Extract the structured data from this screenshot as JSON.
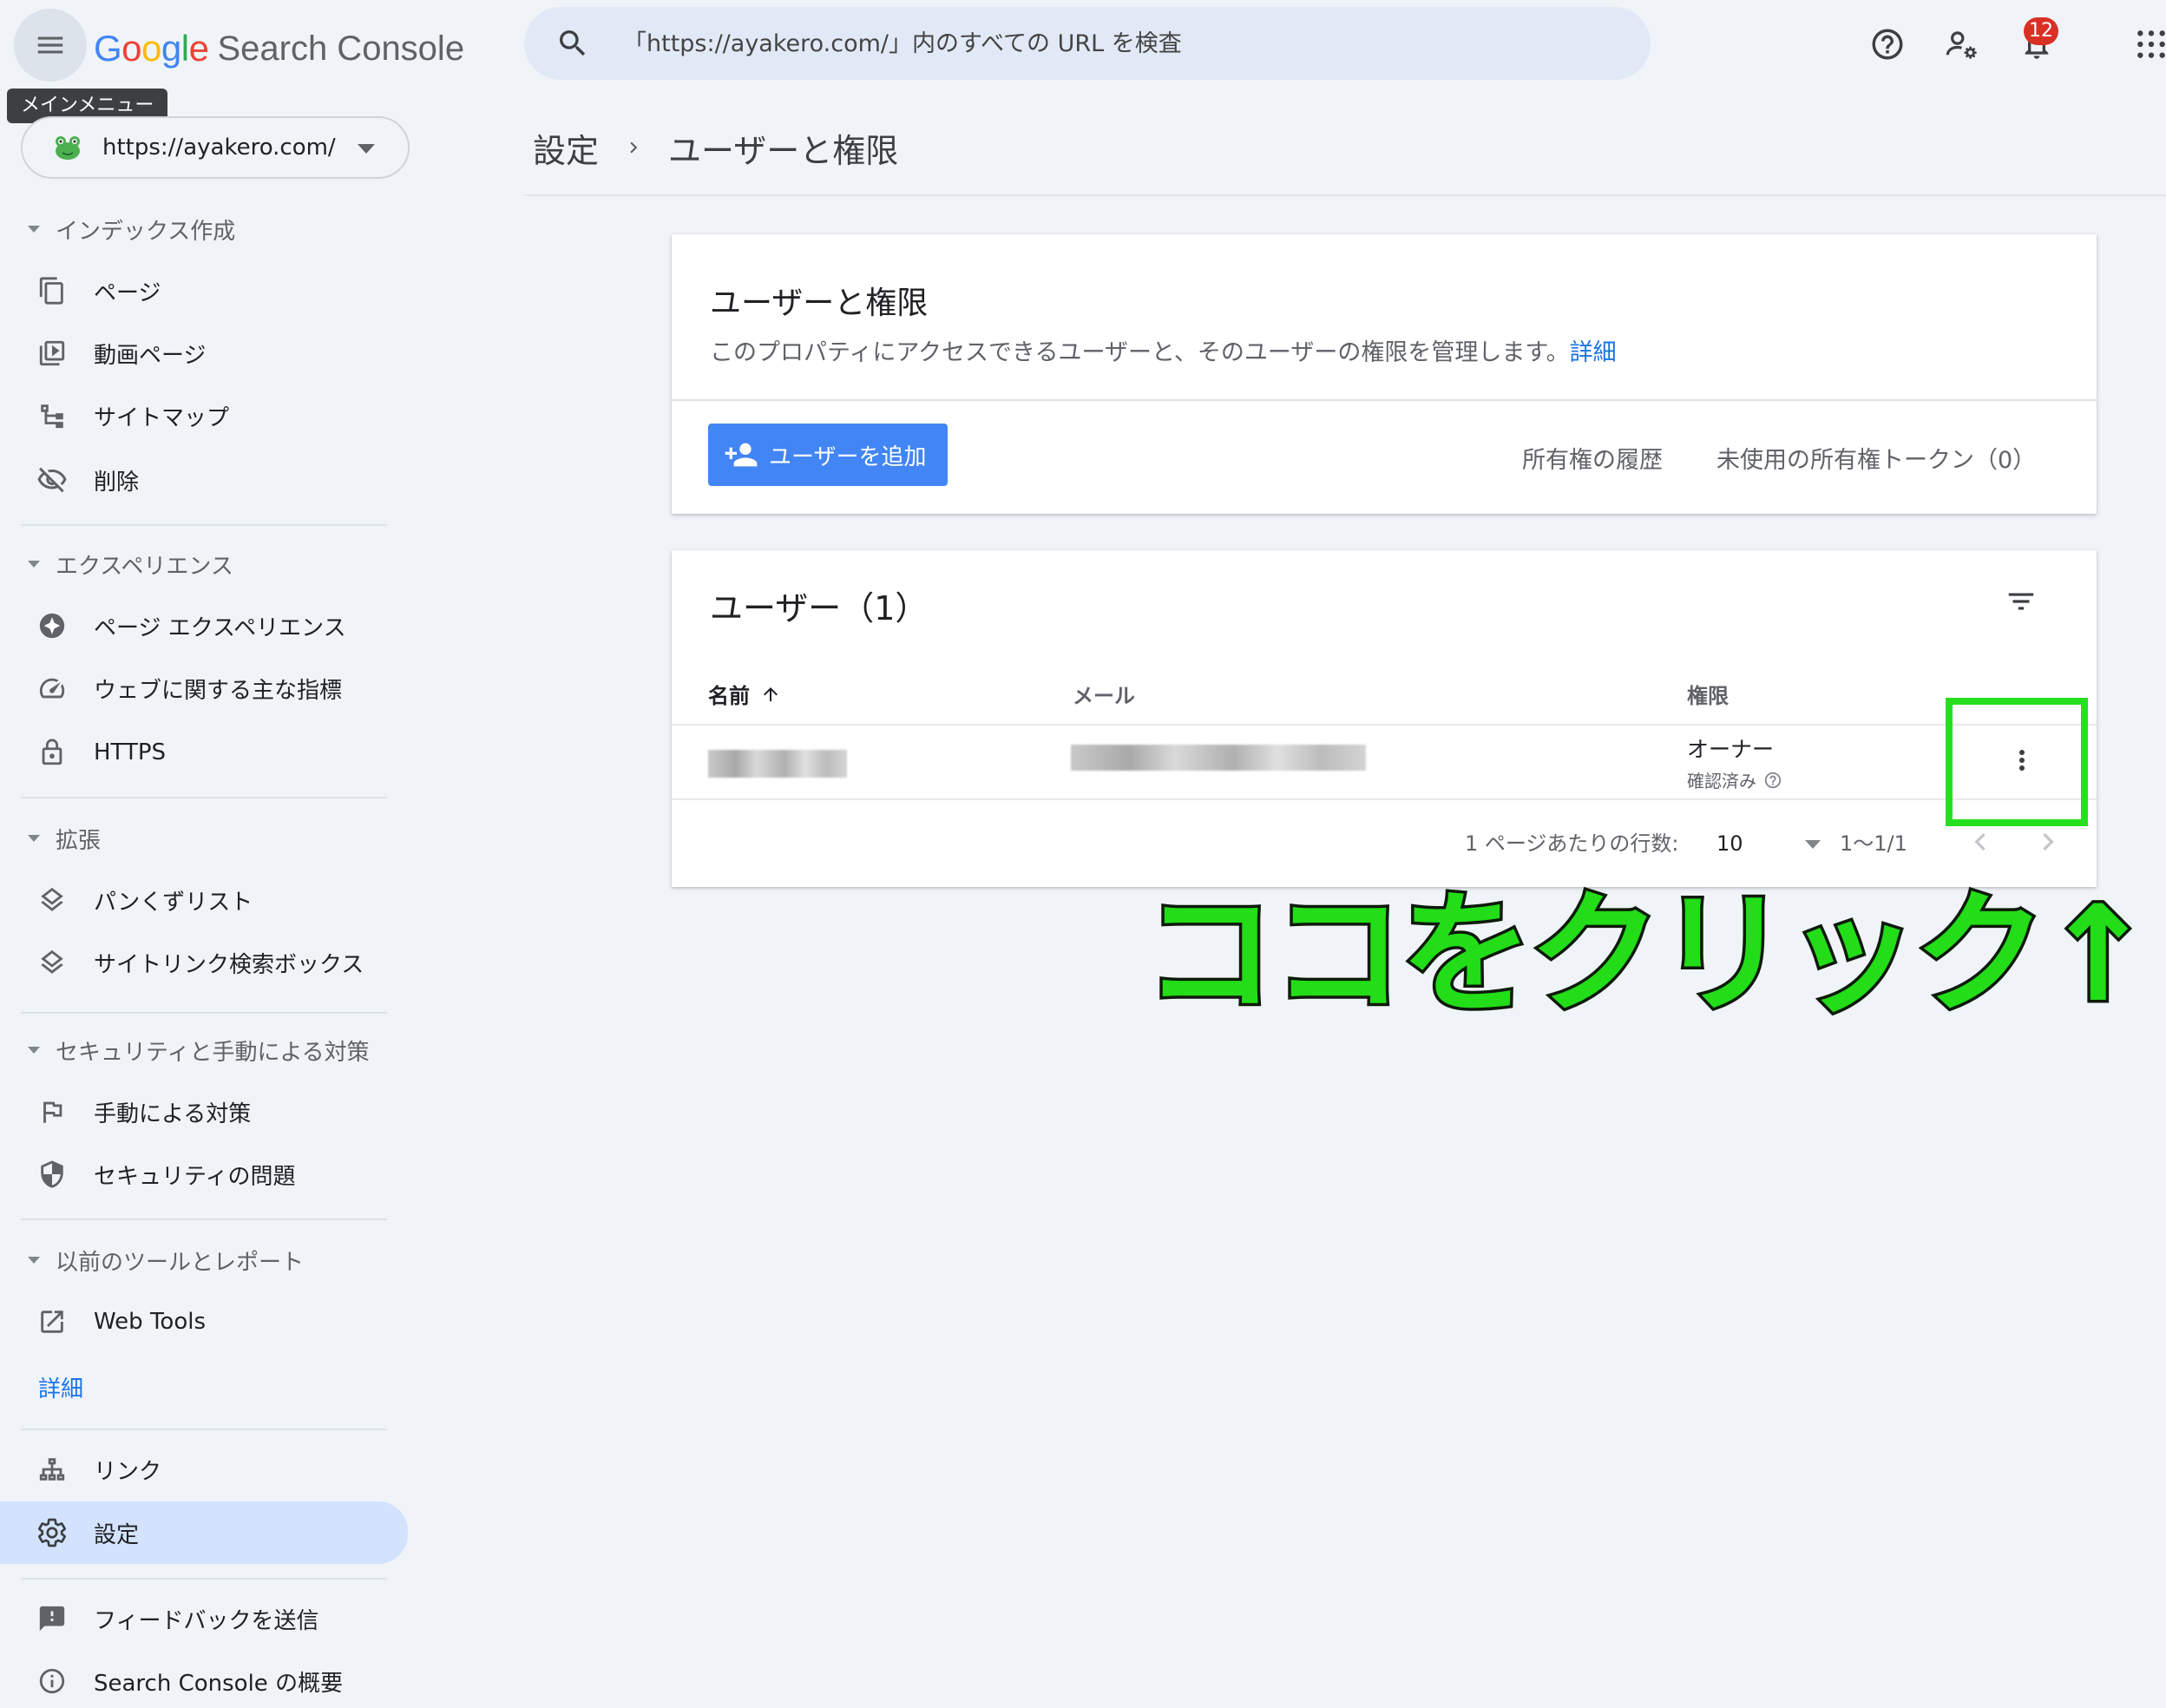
{
  "header": {
    "menu_tooltip": "メインメニュー",
    "logo_letters": [
      "G",
      "o",
      "o",
      "g",
      "l",
      "e"
    ],
    "logo_colors": [
      "#4285f4",
      "#ea4335",
      "#fbbc05",
      "#4285f4",
      "#34a853",
      "#ea4335"
    ],
    "product": "Search Console",
    "search_placeholder": "「https://ayakero.com/」内のすべての URL を検査",
    "notification_count": "12",
    "icons": [
      "menu-icon",
      "search-icon",
      "help-icon",
      "admin-settings-icon",
      "bell-icon",
      "apps-grid-icon"
    ]
  },
  "sidebar": {
    "property": "https://ayakero.com/",
    "sections": [
      {
        "title": "インデックス作成",
        "items": [
          {
            "label": "ページ",
            "icon": "pages-icon"
          },
          {
            "label": "動画ページ",
            "icon": "video-page-icon"
          },
          {
            "label": "サイトマップ",
            "icon": "sitemap-icon"
          },
          {
            "label": "削除",
            "icon": "removal-eye-off-icon"
          }
        ]
      },
      {
        "title": "エクスペリエンス",
        "items": [
          {
            "label": "ページ エクスペリエンス",
            "icon": "page-experience-icon"
          },
          {
            "label": "ウェブに関する主な指標",
            "icon": "speedometer-icon"
          },
          {
            "label": "HTTPS",
            "icon": "lock-icon"
          }
        ]
      },
      {
        "title": "拡張",
        "items": [
          {
            "label": "パンくずリスト",
            "icon": "layers-icon"
          },
          {
            "label": "サイトリンク検索ボックス",
            "icon": "layers-icon"
          }
        ]
      },
      {
        "title": "セキュリティと手動による対策",
        "items": [
          {
            "label": "手動による対策",
            "icon": "flag-icon"
          },
          {
            "label": "セキュリティの問題",
            "icon": "shield-icon"
          }
        ]
      },
      {
        "title": "以前のツールとレポート",
        "items": [
          {
            "label": "Web Tools",
            "icon": "external-link-icon"
          }
        ]
      }
    ],
    "more_label": "詳細",
    "bottom_items": [
      {
        "label": "リンク",
        "icon": "links-icon"
      },
      {
        "label": "設定",
        "icon": "gear-icon",
        "active": true
      }
    ],
    "footer_items": [
      {
        "label": "フィードバックを送信",
        "icon": "feedback-icon"
      },
      {
        "label": "Search Console の概要",
        "icon": "info-icon"
      }
    ]
  },
  "breadcrumb": {
    "parent": "設定",
    "current": "ユーザーと権限"
  },
  "perm_card": {
    "title": "ユーザーと権限",
    "description": "このプロパティにアクセスできるユーザーと、そのユーザーの権限を管理します。",
    "learn_more": "詳細",
    "add_user": "ユーザーを追加",
    "owner_history": "所有権の履歴",
    "unused_tokens": "未使用の所有権トークン（0）"
  },
  "users_card": {
    "title": "ユーザー（1）",
    "columns": {
      "name": "名前",
      "email": "メール",
      "permission": "権限"
    },
    "rows": [
      {
        "name": "",
        "email": "",
        "role": "オーナー",
        "status": "確認済み"
      }
    ],
    "pager": {
      "rows_per_page_label": "1 ページあたりの行数:",
      "rows_per_page": "10",
      "range": "1〜1/1"
    }
  },
  "annotation": {
    "text": "ココをクリック↑",
    "color": "#22dd18"
  },
  "colors": {
    "background": "#f0f4f9",
    "accent_blue": "#4285f4",
    "active_nav": "#d3e3fd",
    "badge_red": "#d93025",
    "highlight_green": "#26e020"
  }
}
